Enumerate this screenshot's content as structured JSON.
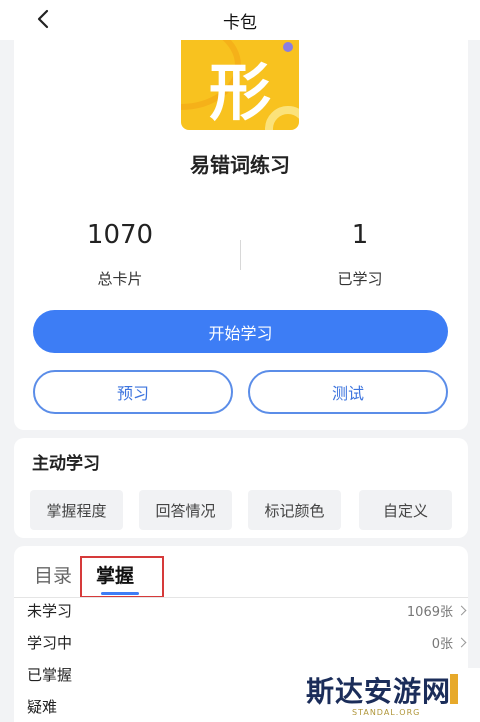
{
  "header": {
    "title": "卡包"
  },
  "deck": {
    "icon_char": "形",
    "title": "易错词练习"
  },
  "stats": [
    {
      "value": "1070",
      "label": "总卡片"
    },
    {
      "value": "1",
      "label": "已学习"
    }
  ],
  "buttons": {
    "start": "开始学习",
    "preview": "预习",
    "test": "测试"
  },
  "active_study": {
    "title": "主动学习",
    "chips": [
      "掌握程度",
      "回答情况",
      "标记颜色",
      "自定义"
    ]
  },
  "tabs": {
    "items": [
      "目录",
      "掌握"
    ],
    "active": "掌握"
  },
  "mastery_rows": [
    {
      "label": "未学习",
      "count": "1069张"
    },
    {
      "label": "学习中",
      "count": "0张"
    },
    {
      "label": "已掌握",
      "count": ""
    },
    {
      "label": "疑难",
      "count": ""
    }
  ],
  "watermark": {
    "text": "斯达安游网",
    "sub": "STANDAL.ORG"
  },
  "colors": {
    "accent": "#3d7df5",
    "icon_bg": "#f8c21f",
    "highlight": "#d63a3a"
  }
}
